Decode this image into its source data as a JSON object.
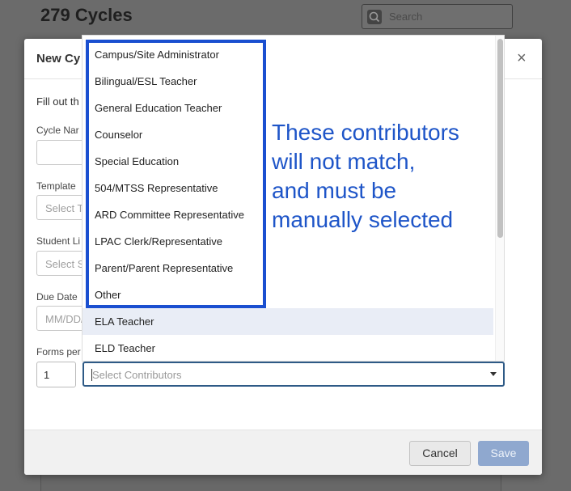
{
  "background": {
    "title": "279 Cycles",
    "search": {
      "placeholder": "Search"
    }
  },
  "modal": {
    "title": "New Cy",
    "intro": "Fill out th",
    "fields": [
      {
        "label": "Cycle Nar",
        "placeholder": ""
      },
      {
        "label": "Template",
        "placeholder": "Select T"
      },
      {
        "label": "Student Li",
        "placeholder": "Select S"
      },
      {
        "label": "Due Date",
        "placeholder": "MM/DD/"
      }
    ],
    "forms_per_label": "Forms per",
    "forms_per_value": "1",
    "contributors_placeholder": "Select Contributors",
    "cancel_label": "Cancel",
    "save_label": "Save",
    "close_glyph": "×"
  },
  "dropdown": {
    "items": [
      "Campus/Site Administrator",
      "Bilingual/ESL Teacher",
      "General Education Teacher",
      "Counselor",
      "Special Education",
      "504/MTSS Representative",
      "ARD Committee Representative",
      "LPAC Clerk/Representative",
      "Parent/Parent Representative",
      "Other",
      "ELA Teacher",
      "ELD Teacher"
    ],
    "highlighted_index": 10
  },
  "annotation": {
    "lines": [
      "These contributors",
      "will not match,",
      "and must be",
      "manually selected"
    ],
    "color": "#1e55c8"
  },
  "colors": {
    "accent": "#2e5a86",
    "save_button": "#8fa8cf",
    "annotation_box": "#1a4fd0"
  }
}
